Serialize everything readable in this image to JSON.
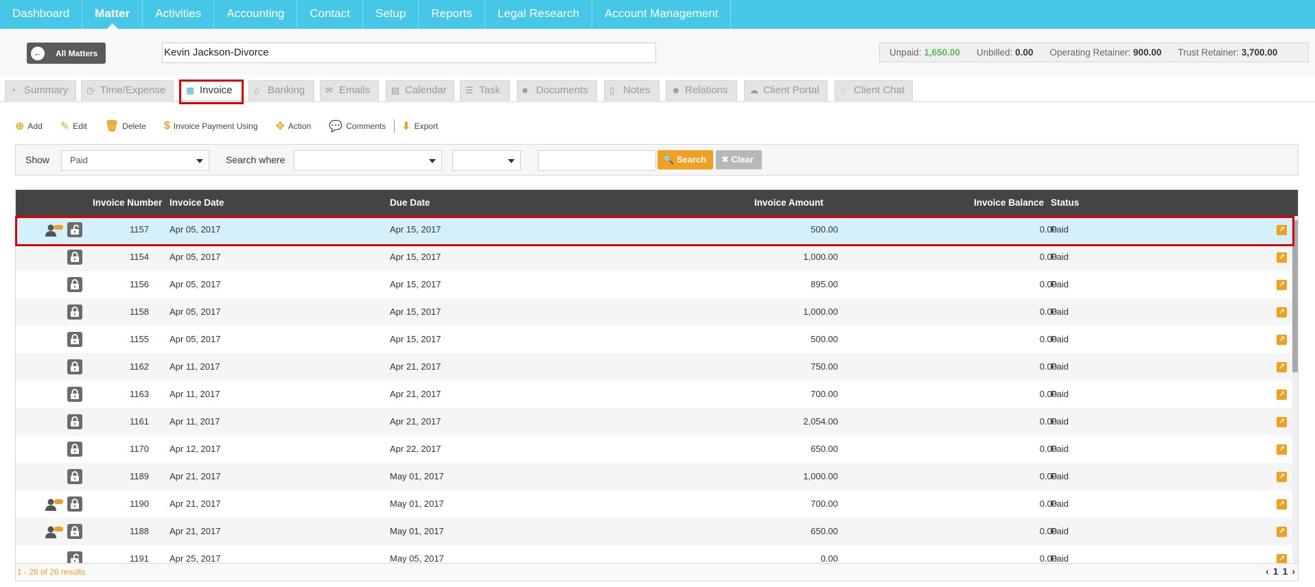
{
  "nav": [
    "Dashboard",
    "Matter",
    "Activities",
    "Accounting",
    "Contact",
    "Setup",
    "Reports",
    "Legal Research",
    "Account Management"
  ],
  "matter": {
    "back_label": "All Matters",
    "name": "Kevin Jackson-Divorce",
    "unpaid_label": "Unpaid:",
    "unpaid_value": "1,650.00",
    "unbilled_label": "Unbilled:",
    "unbilled_value": "0.00",
    "operating_label": "Operating Retainer:",
    "operating_value": "900.00",
    "trust_label": "Trust Retainer:",
    "trust_value": "3,700.00"
  },
  "tabs": [
    "Summary",
    "Time/Expense",
    "Invoice",
    "Banking",
    "Emails",
    "Calendar",
    "Task",
    "Documents",
    "Notes",
    "Relations",
    "Client Portal",
    "Client Chat"
  ],
  "active_tab": "Invoice",
  "toolbar": {
    "add": "Add",
    "edit": "Edit",
    "delete": "Delete",
    "payment": "Invoice Payment Using",
    "action": "Action",
    "comments": "Comments",
    "export": "Export"
  },
  "filter": {
    "show_label": "Show",
    "show_value": "Paid",
    "search_where_label": "Search where",
    "search_btn": "Search",
    "clear_btn": "Clear"
  },
  "grid": {
    "headers": {
      "number": "Invoice Number",
      "date": "Invoice Date",
      "due": "Due Date",
      "amount": "Invoice Amount",
      "balance": "Invoice Balance",
      "status": "Status"
    },
    "rows": [
      {
        "number": "1157",
        "date": "Apr 05, 2017",
        "due": "Apr 15, 2017",
        "amount": "500.00",
        "balance": "0.00",
        "status": "Paid"
      },
      {
        "number": "1154",
        "date": "Apr 05, 2017",
        "due": "Apr 15, 2017",
        "amount": "1,000.00",
        "balance": "0.00",
        "status": "Paid"
      },
      {
        "number": "1156",
        "date": "Apr 05, 2017",
        "due": "Apr 15, 2017",
        "amount": "895.00",
        "balance": "0.00",
        "status": "Paid"
      },
      {
        "number": "1158",
        "date": "Apr 05, 2017",
        "due": "Apr 15, 2017",
        "amount": "1,000.00",
        "balance": "0.00",
        "status": "Paid"
      },
      {
        "number": "1155",
        "date": "Apr 05, 2017",
        "due": "Apr 15, 2017",
        "amount": "500.00",
        "balance": "0.00",
        "status": "Paid"
      },
      {
        "number": "1162",
        "date": "Apr 11, 2017",
        "due": "Apr 21, 2017",
        "amount": "750.00",
        "balance": "0.00",
        "status": "Paid"
      },
      {
        "number": "1163",
        "date": "Apr 11, 2017",
        "due": "Apr 21, 2017",
        "amount": "700.00",
        "balance": "0.00",
        "status": "Paid"
      },
      {
        "number": "1161",
        "date": "Apr 11, 2017",
        "due": "Apr 21, 2017",
        "amount": "2,054.00",
        "balance": "0.00",
        "status": "Paid"
      },
      {
        "number": "1170",
        "date": "Apr 12, 2017",
        "due": "Apr 22, 2017",
        "amount": "650.00",
        "balance": "0.00",
        "status": "Paid"
      },
      {
        "number": "1189",
        "date": "Apr 21, 2017",
        "due": "May 01, 2017",
        "amount": "1,000.00",
        "balance": "0.00",
        "status": "Paid"
      },
      {
        "number": "1190",
        "date": "Apr 21, 2017",
        "due": "May 01, 2017",
        "amount": "700.00",
        "balance": "0.00",
        "status": "Paid"
      },
      {
        "number": "1188",
        "date": "Apr 21, 2017",
        "due": "May 01, 2017",
        "amount": "650.00",
        "balance": "0.00",
        "status": "Paid"
      },
      {
        "number": "1191",
        "date": "Apr 25, 2017",
        "due": "May 05, 2017",
        "amount": "0.00",
        "balance": "0.00",
        "status": "Paid"
      }
    ],
    "footer_count": "1 - 26 of 26 results",
    "pager": {
      "prev": "‹",
      "page": "1",
      "total": "1",
      "next": "›"
    }
  },
  "colors": {
    "nav": "#45c8e8",
    "accent": "#f0a020",
    "selected_row": "#d4f1fb",
    "highlight": "#e00000"
  }
}
